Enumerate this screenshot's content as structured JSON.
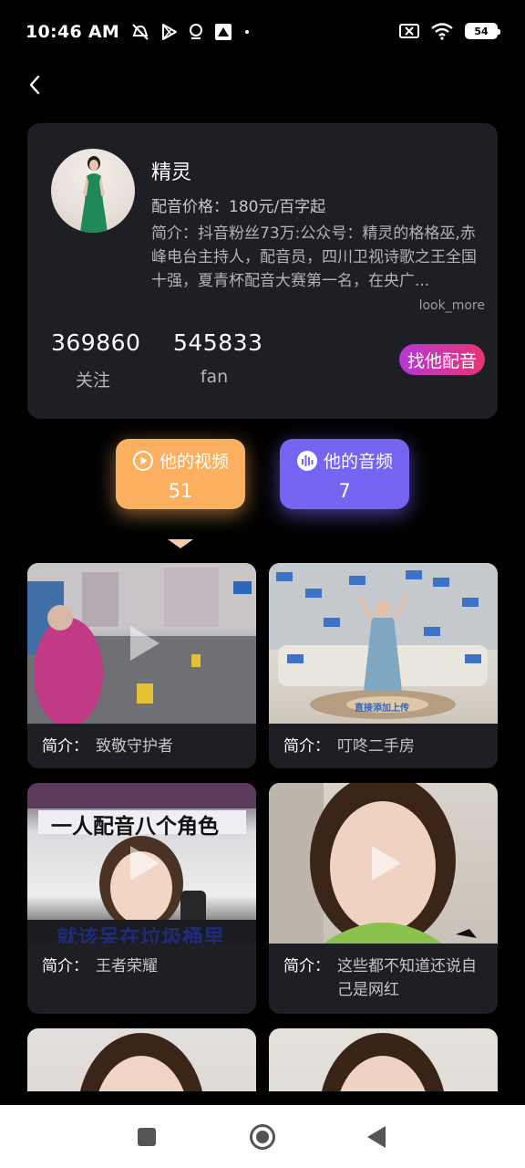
{
  "status_bar": {
    "time": "10:46 AM",
    "battery": "54"
  },
  "profile": {
    "name": "精灵",
    "price": "配音价格：180元/百字起",
    "intro": "简介：抖音粉丝73万:公众号：精灵的格格巫,赤峰电台主持人，配音员，四川卫视诗歌之王全国十强，夏青杯配音大赛第一名，在央广...",
    "look_more": "look_more",
    "follow_count": "369860",
    "follow_label": "关注",
    "fan_count": "545833",
    "fan_label": "fan",
    "dub_button": "找他配音"
  },
  "tabs": {
    "video": {
      "label": "他的视频",
      "count": "51"
    },
    "audio": {
      "label": "他的音频",
      "count": "7"
    }
  },
  "videos": [
    {
      "label": "简介：",
      "text": "致敬守护者"
    },
    {
      "label": "简介：",
      "text": "叮咚二手房",
      "overlay": "直接添加上传"
    },
    {
      "label": "简介：",
      "text": "王者荣耀",
      "overlay_top": "一人配音八个角色",
      "overlay_bottom": "就该呆在垃圾桶里"
    },
    {
      "label": "简介：",
      "text": "这些都不知道还说自己是网红"
    },
    {
      "label": "",
      "text": ""
    },
    {
      "label": "",
      "text": ""
    }
  ],
  "colors": {
    "video_tab": "#fbb060",
    "audio_tab": "#7565f3",
    "card": "#1e1f24"
  }
}
